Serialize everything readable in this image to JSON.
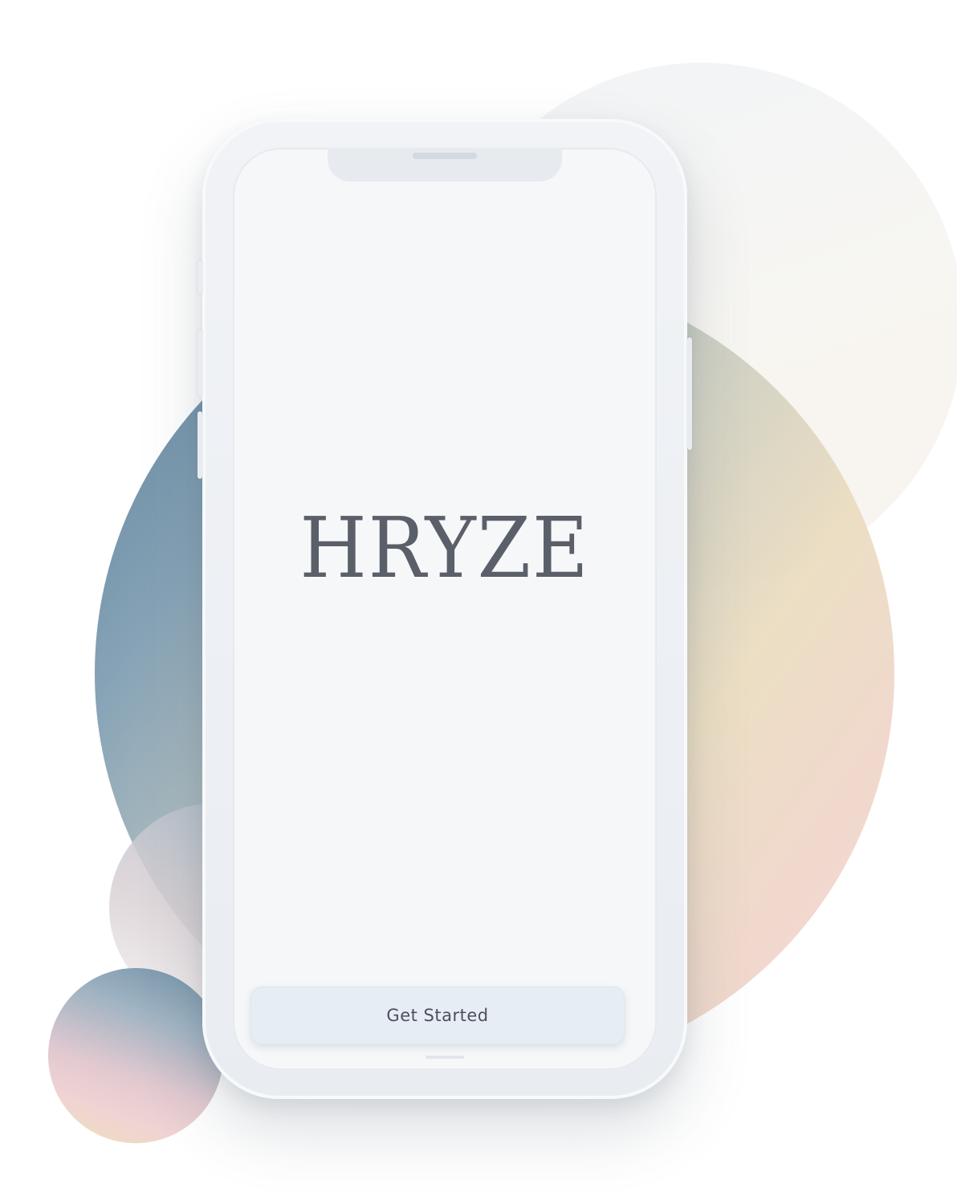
{
  "app": {
    "logo_text": "HRYZE"
  },
  "actions": {
    "get_started_label": "Get Started"
  },
  "colors": {
    "screen_background": "#f6f7f9",
    "logo_text": "#5b5f69",
    "button_background": "#e7edf4",
    "button_text": "#4b505a",
    "blob_blue": "#4f7691",
    "blob_sand": "#eadcbf",
    "blob_pink": "#f2d2cd"
  }
}
